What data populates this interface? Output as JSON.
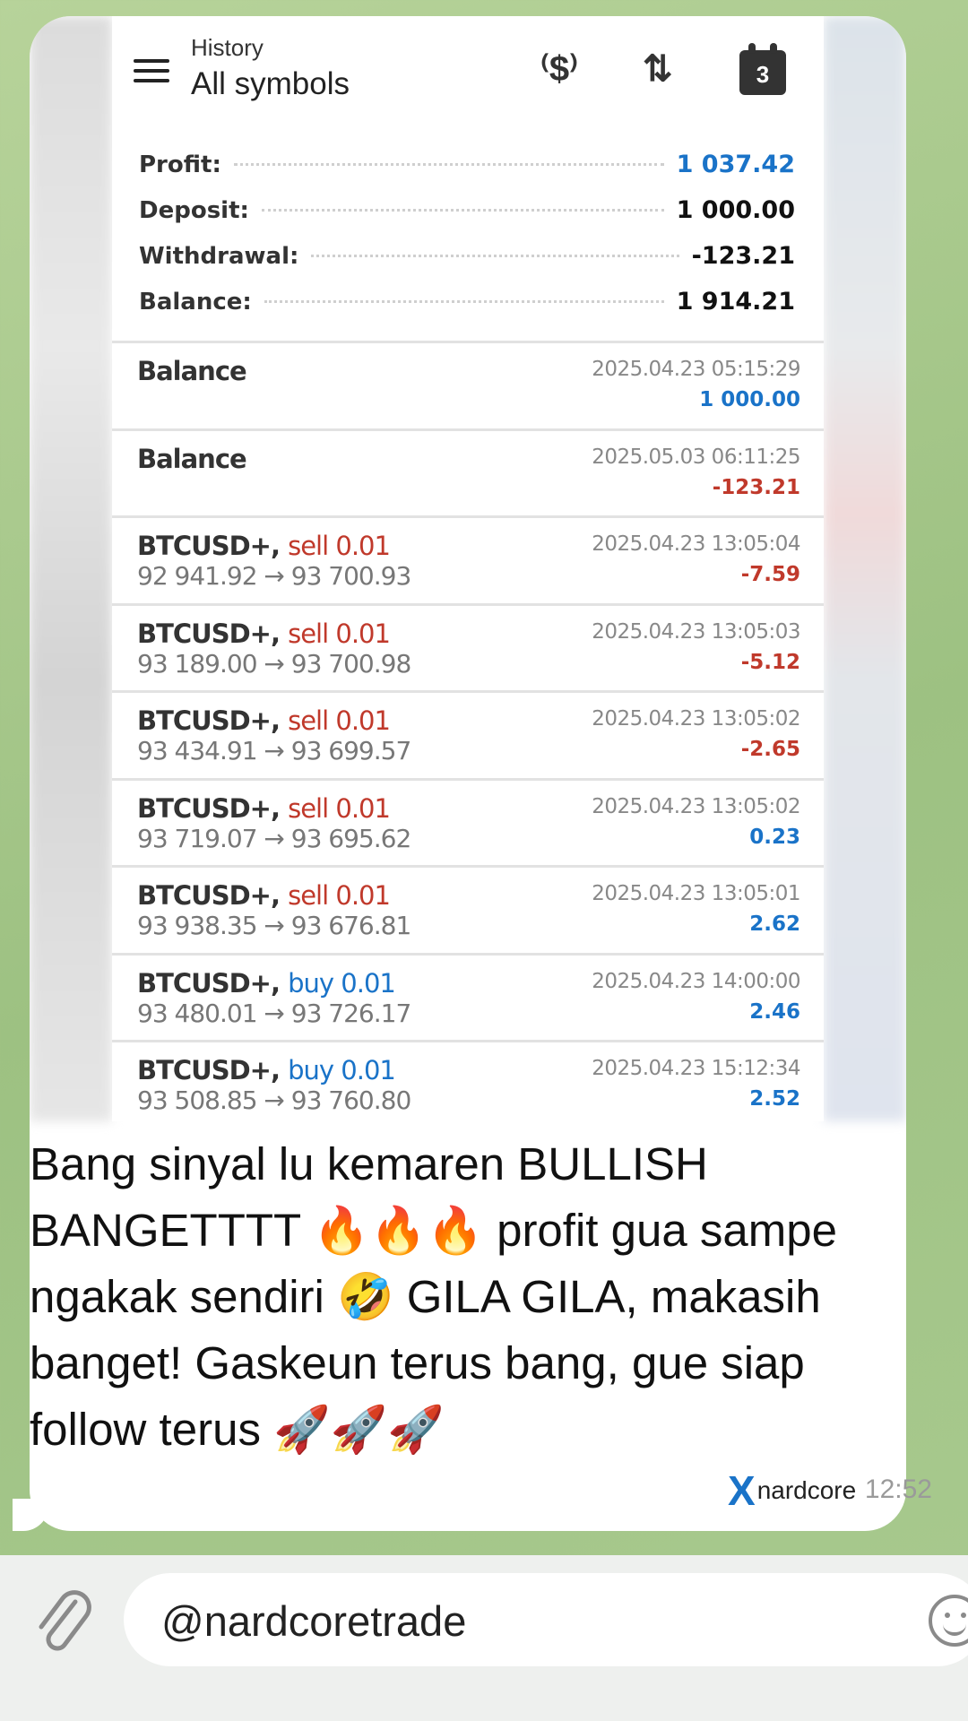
{
  "history": {
    "subtitle": "History",
    "title": "All symbols",
    "calendar_day": "3",
    "icons": {
      "dollar": "currency-exchange-icon",
      "sort": "sort-icon",
      "calendar": "calendar-icon",
      "menu": "menu-icon"
    }
  },
  "summary": [
    {
      "label": "Profit:",
      "value": "1 037.42",
      "accent": "blue"
    },
    {
      "label": "Deposit:",
      "value": "1 000.00",
      "accent": ""
    },
    {
      "label": "Withdrawal:",
      "value": "-123.21",
      "accent": ""
    },
    {
      "label": "Balance:",
      "value": "1 914.21",
      "accent": ""
    }
  ],
  "deals": [
    {
      "symbol": "Balance",
      "side": "",
      "prices": "",
      "time": "2025.04.23 05:15:29",
      "profit": "1 000.00",
      "sign": "pos"
    },
    {
      "symbol": "Balance",
      "side": "",
      "prices": "",
      "time": "2025.05.03 06:11:25",
      "profit": "-123.21",
      "sign": "neg"
    },
    {
      "symbol": "BTCUSD+,",
      "side": "sell 0.01",
      "side_type": "sell",
      "prices": "92 941.92 → 93 700.93",
      "time": "2025.04.23 13:05:04",
      "profit": "-7.59",
      "sign": "neg"
    },
    {
      "symbol": "BTCUSD+,",
      "side": "sell 0.01",
      "side_type": "sell",
      "prices": "93 189.00 → 93 700.98",
      "time": "2025.04.23 13:05:03",
      "profit": "-5.12",
      "sign": "neg"
    },
    {
      "symbol": "BTCUSD+,",
      "side": "sell 0.01",
      "side_type": "sell",
      "prices": "93 434.91 → 93 699.57",
      "time": "2025.04.23 13:05:02",
      "profit": "-2.65",
      "sign": "neg"
    },
    {
      "symbol": "BTCUSD+,",
      "side": "sell 0.01",
      "side_type": "sell",
      "prices": "93 719.07 → 93 695.62",
      "time": "2025.04.23 13:05:02",
      "profit": "0.23",
      "sign": "pos"
    },
    {
      "symbol": "BTCUSD+,",
      "side": "sell 0.01",
      "side_type": "sell",
      "prices": "93 938.35 → 93 676.81",
      "time": "2025.04.23 13:05:01",
      "profit": "2.62",
      "sign": "pos"
    },
    {
      "symbol": "BTCUSD+,",
      "side": "buy 0.01",
      "side_type": "buy",
      "prices": "93 480.01 → 93 726.17",
      "time": "2025.04.23 14:00:00",
      "profit": "2.46",
      "sign": "pos"
    },
    {
      "symbol": "BTCUSD+,",
      "side": "buy 0.01",
      "side_type": "buy",
      "prices": "93 508.85 → 93 760.80",
      "time": "2025.04.23 15:12:34",
      "profit": "2.52",
      "sign": "pos"
    }
  ],
  "message": {
    "text": "Bang sinyal lu kemaren BULLISH BANGETTTT 🔥🔥🔥 profit gua sampe ngakak sendiri 🤣 GILA GILA, makasih banget! Gaskeun terus bang, gue siap follow terus 🚀🚀🚀",
    "time": "12:52",
    "watermark": "nardcore"
  },
  "input": {
    "value": "@nardcoretrade"
  },
  "colors": {
    "profit_blue": "#1a73c8",
    "loss_red": "#c0392b",
    "chat_bg": "#a8c98d"
  }
}
